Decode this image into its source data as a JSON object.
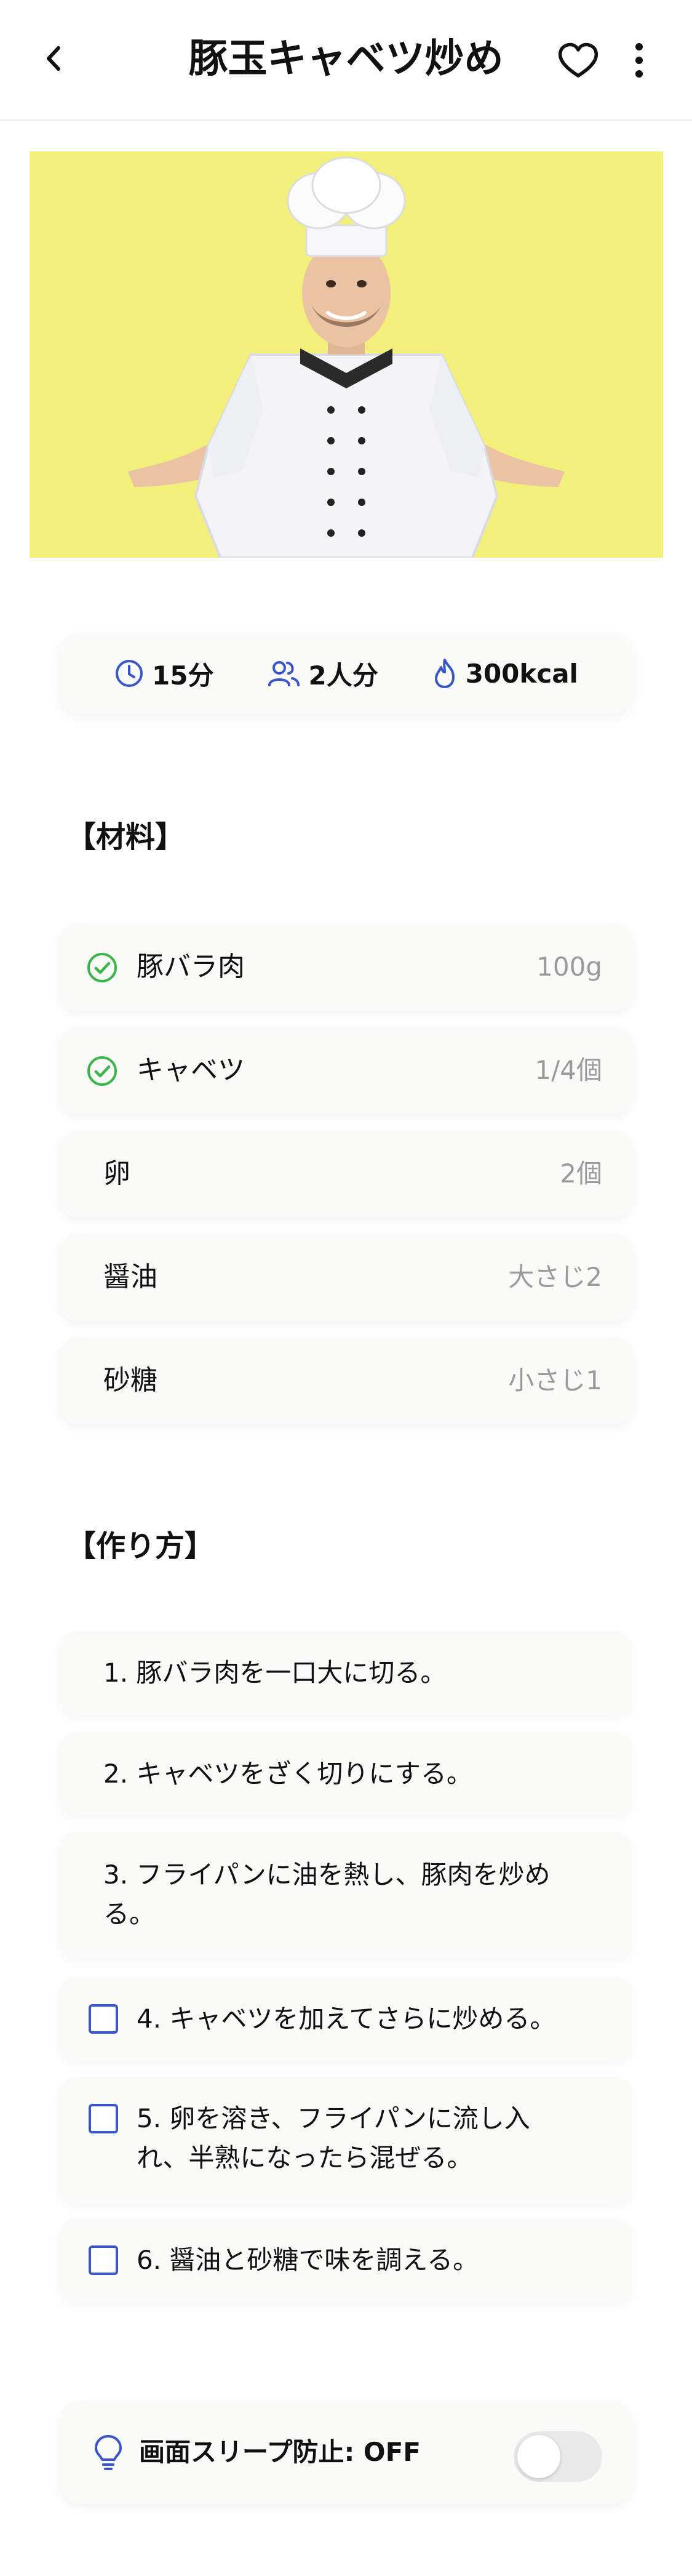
{
  "header": {
    "title": "豚玉キャベツ炒め",
    "back_icon": "chevron-left-icon",
    "favorite_icon": "heart-outline-icon",
    "more_icon": "more-vertical-icon"
  },
  "hero": {
    "alt": "chef-photo"
  },
  "stats": {
    "time": "15分",
    "servings": "2人分",
    "calories": "300kcal"
  },
  "ingredients": {
    "title": "【材料】",
    "items": [
      {
        "name": "豚バラ肉",
        "amount": "100g",
        "checked": true
      },
      {
        "name": "キャベツ",
        "amount": "1/4個",
        "checked": true
      },
      {
        "name": "卵",
        "amount": "2個",
        "checked": false
      },
      {
        "name": "醤油",
        "amount": "大さじ2",
        "checked": false
      },
      {
        "name": "砂糖",
        "amount": "小さじ1",
        "checked": false
      }
    ]
  },
  "steps": {
    "title": "【作り方】",
    "items": [
      {
        "line1": "1. 豚バラ肉を一口大に切る。",
        "line2": ""
      },
      {
        "line1": "2. キャベツをざく切りにする。",
        "line2": ""
      },
      {
        "line1": "3. フライパンに油を熱し、豚肉を炒め",
        "line2": "る。"
      },
      {
        "line1": "4. キャベツを加えてさらに炒める。",
        "line2": ""
      },
      {
        "line1": "5. 卵を溶き、フライパンに流し入",
        "line2": "れ、半熟になったら混ぜる。"
      },
      {
        "line1": "6. 醤油と砂糖で味を調える。",
        "line2": ""
      }
    ]
  },
  "sleep_guard": {
    "label": "画面スリープ防止: OFF",
    "enabled": false
  },
  "colors": {
    "accent_blue": "#3a55c8",
    "check_green": "#3bb54a",
    "hero_bg": "#f2f07a"
  }
}
